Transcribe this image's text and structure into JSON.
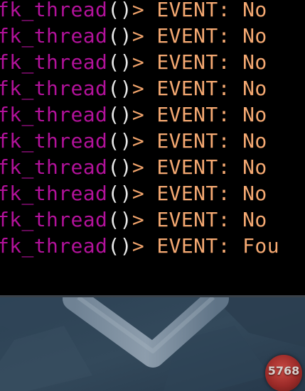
{
  "terminal": {
    "lines": [
      {
        "func": "fk_thread",
        "paren": "()",
        "prompt": ">",
        "message": "EVENT: No"
      },
      {
        "func": "fk_thread",
        "paren": "()",
        "prompt": ">",
        "message": "EVENT: No"
      },
      {
        "func": "fk_thread",
        "paren": "()",
        "prompt": ">",
        "message": "EVENT: No"
      },
      {
        "func": "fk_thread",
        "paren": "()",
        "prompt": ">",
        "message": "EVENT: No"
      },
      {
        "func": "fk_thread",
        "paren": "()",
        "prompt": ">",
        "message": "EVENT: No"
      },
      {
        "func": "fk_thread",
        "paren": "()",
        "prompt": ">",
        "message": "EVENT: No"
      },
      {
        "func": "fk_thread",
        "paren": "()",
        "prompt": ">",
        "message": "EVENT: No"
      },
      {
        "func": "fk_thread",
        "paren": "()",
        "prompt": ">",
        "message": "EVENT: No"
      },
      {
        "func": "fk_thread",
        "paren": "()",
        "prompt": ">",
        "message": "EVENT: No"
      },
      {
        "func": "fk_thread",
        "paren": "()",
        "prompt": ">",
        "message": "EVENT: Fou"
      }
    ]
  },
  "badge": {
    "count": "5768"
  },
  "colors": {
    "function": "#b3129b",
    "paren": "#e8e8e8",
    "message": "#f5a972",
    "terminal_bg": "#000000",
    "badge": "#9b2a28"
  }
}
